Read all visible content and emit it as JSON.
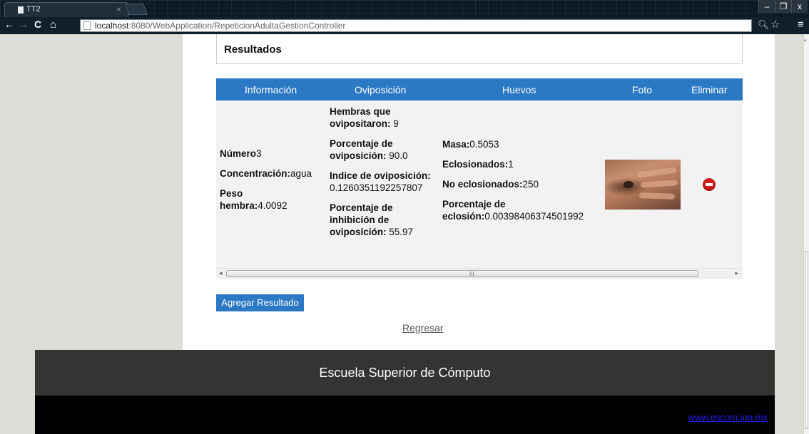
{
  "browser": {
    "tab_title": "TT2",
    "tab_close": "×",
    "url_host": "localhost",
    "url_rest": ":8080/WebApplication/RepeticionAdultaGestionController",
    "nav_back": "←",
    "nav_forward": "→",
    "nav_reload": "C",
    "nav_home": "⌂",
    "zoom_icon": "magnifier-icon",
    "star_icon": "star-icon",
    "menu_icon": "menu-icon",
    "window_buttons": [
      "–",
      "❐",
      "x"
    ]
  },
  "page": {
    "section_title": "Resultados",
    "table": {
      "headers": [
        "Información",
        "Oviposición",
        "Huevos",
        "Foto",
        "Eliminar"
      ],
      "header_color": "#2b78c5",
      "row": {
        "informacion": {
          "numero_label": "Número",
          "numero_value": "3",
          "concentracion_label": "Concentración:",
          "concentracion_value": "agua",
          "peso_label": "Peso hembra:",
          "peso_value": "4.0092"
        },
        "oviposicion": {
          "hembras_label": "Hembras que ovipositaron:",
          "hembras_value": "9",
          "porcentaje_label": "Porcentaje de oviposición:",
          "porcentaje_value": "90.0",
          "indice_label": "Indice de oviposición:",
          "indice_value": "0.1260351192257807",
          "inhibicion_label": "Porcentaje de inhibición de oviposición:",
          "inhibicion_value": "55.97"
        },
        "huevos": {
          "masa_label": "Masa:",
          "masa_value": "0.5053",
          "eclosionados_label": "Eclosionados:",
          "eclosionados_value": "1",
          "no_eclosionados_label": "No eclosionados:",
          "no_eclosionados_value": "250",
          "porcentaje_eclosion_label": "Porcentaje de eclosión:",
          "porcentaje_eclosion_value": "0.00398406374501992"
        },
        "foto_icon": "hand-photo",
        "eliminar_icon": "delete-icon"
      },
      "scroll_grip": "III",
      "scroll_left": "◂",
      "scroll_right": "▸"
    },
    "add_button": "Agregar Resultado",
    "back_link": "Regresar"
  },
  "footer": {
    "school": "Escuela Superior de Cómputo",
    "link": "www.escom.ipn.mx"
  }
}
